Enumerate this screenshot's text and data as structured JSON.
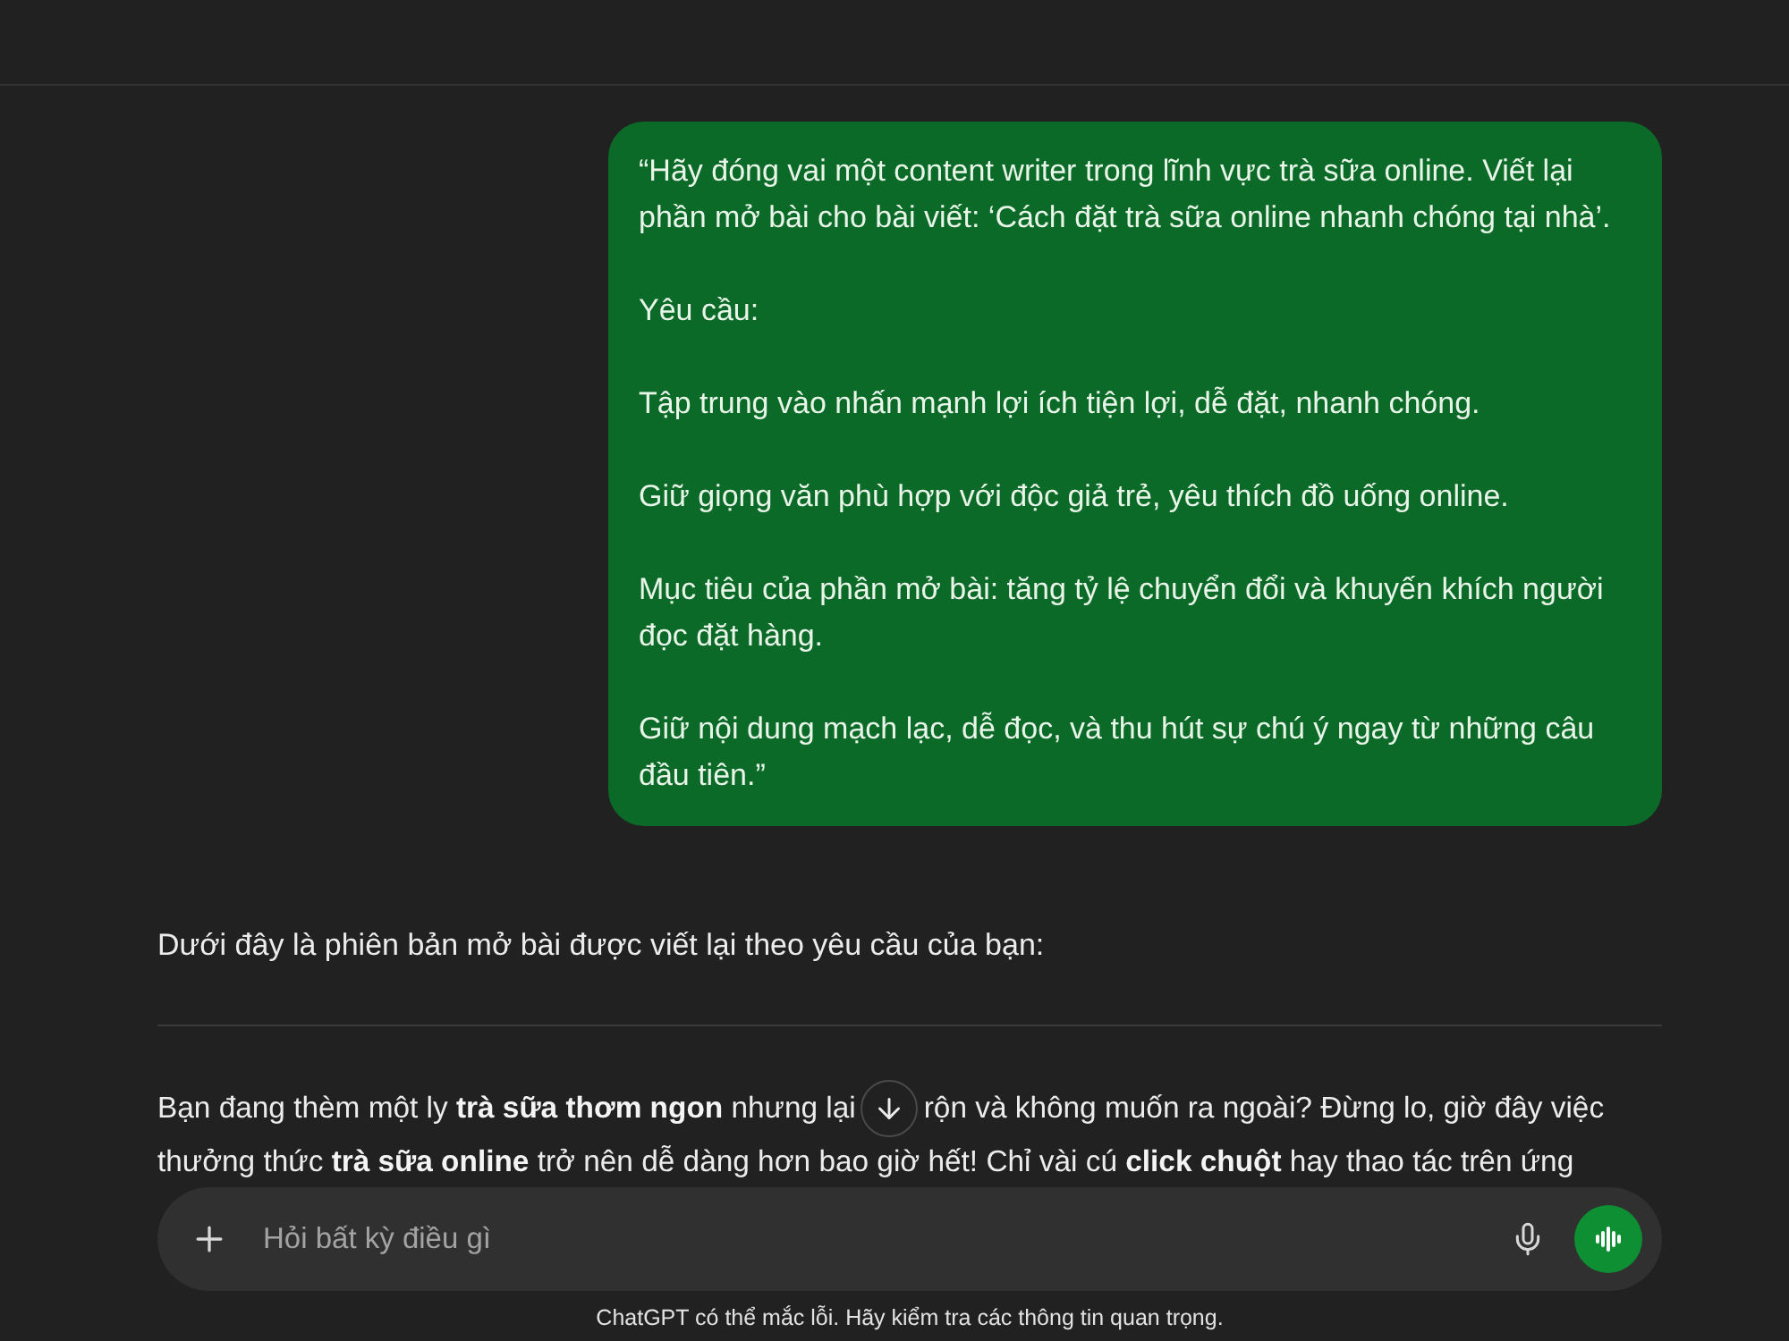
{
  "user_message": {
    "paragraphs": [
      "“Hãy đóng vai một content writer trong lĩnh vực trà sữa online. Viết lại phần mở bài cho bài viết: ‘Cách đặt trà sữa online nhanh chóng tại nhà’.",
      "Yêu cầu:",
      "Tập trung vào nhấn mạnh lợi ích tiện lợi, dễ đặt, nhanh chóng.",
      "Giữ giọng văn phù hợp với độc giả trẻ, yêu thích đồ uống online.",
      "Mục tiêu của phần mở bài: tăng tỷ lệ chuyển đổi và khuyến khích người đọc đặt hàng.",
      "Giữ nội dung mạch lạc, dễ đọc, và thu hút sự chú ý ngay từ những câu đầu tiên.”"
    ]
  },
  "assistant_message": {
    "intro": "Dưới đây là phiên bản mở bài được viết lại theo yêu cầu của bạn:",
    "paragraph_lines": [
      [
        "Bạn đang thèm một ly **trà sữa thơm ngon** nhưng lại",
        "rộn và không muốn ra ngoài? Đừng lo, giờ đây việc"
      ],
      [
        "thưởng thức **trà sữa online** trở nên dễ dàng hơn bao giờ hết! Chỉ vài cú **click chuột** hay thao tác trên ứng"
      ]
    ]
  },
  "composer": {
    "placeholder": "Hỏi bất kỳ điều gì"
  },
  "disclaimer": "ChatGPT có thể mắc lỗi. Hãy kiểm tra các thông tin quan trọng."
}
